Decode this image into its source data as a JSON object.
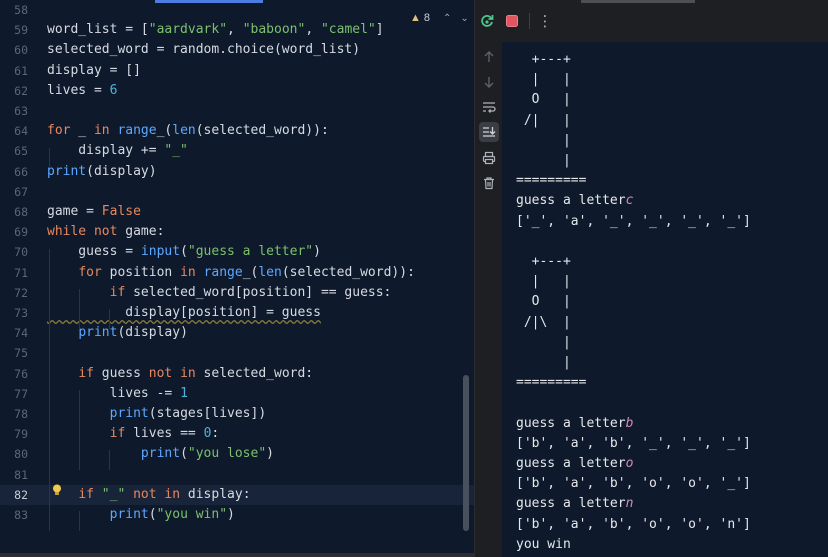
{
  "editor": {
    "warnings": {
      "count": "8"
    },
    "lines": [
      {
        "n": "58",
        "t": []
      },
      {
        "n": "59",
        "t": [
          {
            "s": "word_list = [",
            "c": ""
          },
          {
            "s": "\"aardvark\"",
            "c": "str"
          },
          {
            "s": ", ",
            "c": ""
          },
          {
            "s": "\"baboon\"",
            "c": "str"
          },
          {
            "s": ", ",
            "c": ""
          },
          {
            "s": "\"camel\"",
            "c": "str"
          },
          {
            "s": "]",
            "c": ""
          }
        ]
      },
      {
        "n": "60",
        "t": [
          {
            "s": "selected_word = random.choice(word_list)",
            "c": ""
          }
        ]
      },
      {
        "n": "61",
        "t": [
          {
            "s": "display = []",
            "c": ""
          }
        ]
      },
      {
        "n": "62",
        "t": [
          {
            "s": "lives = ",
            "c": ""
          },
          {
            "s": "6",
            "c": "num"
          }
        ]
      },
      {
        "n": "63",
        "t": []
      },
      {
        "n": "64",
        "t": [
          {
            "s": "for",
            "c": "kw"
          },
          {
            "s": " _ ",
            "c": ""
          },
          {
            "s": "in",
            "c": "kw"
          },
          {
            "s": " ",
            "c": ""
          },
          {
            "s": "range",
            "c": "fn"
          },
          {
            "s": "_(",
            "c": ""
          },
          {
            "s": "len",
            "c": "fn"
          },
          {
            "s": "(selected_word)):",
            "c": ""
          }
        ]
      },
      {
        "n": "65",
        "t": [
          {
            "s": "    display += ",
            "c": ""
          },
          {
            "s": "\"_\"",
            "c": "str"
          }
        ]
      },
      {
        "n": "66",
        "t": [
          {
            "s": "print",
            "c": "fn"
          },
          {
            "s": "(display)",
            "c": ""
          }
        ]
      },
      {
        "n": "67",
        "t": []
      },
      {
        "n": "68",
        "t": [
          {
            "s": "game = ",
            "c": ""
          },
          {
            "s": "False",
            "c": "kw"
          }
        ]
      },
      {
        "n": "69",
        "t": [
          {
            "s": "while",
            "c": "kw"
          },
          {
            "s": " ",
            "c": ""
          },
          {
            "s": "not",
            "c": "kw"
          },
          {
            "s": " game:",
            "c": ""
          }
        ]
      },
      {
        "n": "70",
        "t": [
          {
            "s": "    guess = ",
            "c": ""
          },
          {
            "s": "input",
            "c": "fn"
          },
          {
            "s": "(",
            "c": ""
          },
          {
            "s": "\"guess a letter\"",
            "c": "str"
          },
          {
            "s": ")",
            "c": ""
          }
        ]
      },
      {
        "n": "71",
        "t": [
          {
            "s": "    ",
            "c": ""
          },
          {
            "s": "for",
            "c": "kw"
          },
          {
            "s": " position ",
            "c": ""
          },
          {
            "s": "in",
            "c": "kw"
          },
          {
            "s": " ",
            "c": ""
          },
          {
            "s": "range",
            "c": "fn"
          },
          {
            "s": "_(",
            "c": ""
          },
          {
            "s": "len",
            "c": "fn"
          },
          {
            "s": "(selected_word)):",
            "c": ""
          }
        ]
      },
      {
        "n": "72",
        "t": [
          {
            "s": "        ",
            "c": ""
          },
          {
            "s": "if",
            "c": "kw"
          },
          {
            "s": " selected_word[position] == guess:",
            "c": ""
          }
        ]
      },
      {
        "n": "73",
        "t": [
          {
            "s": "          display[position] = guess",
            "c": ""
          }
        ]
      },
      {
        "n": "74",
        "t": [
          {
            "s": "    ",
            "c": ""
          },
          {
            "s": "print",
            "c": "fn"
          },
          {
            "s": "(display)",
            "c": ""
          }
        ]
      },
      {
        "n": "75",
        "t": []
      },
      {
        "n": "76",
        "t": [
          {
            "s": "    ",
            "c": ""
          },
          {
            "s": "if",
            "c": "kw"
          },
          {
            "s": " guess ",
            "c": ""
          },
          {
            "s": "not in",
            "c": "kw"
          },
          {
            "s": " selected_word:",
            "c": ""
          }
        ]
      },
      {
        "n": "77",
        "t": [
          {
            "s": "        lives -= ",
            "c": ""
          },
          {
            "s": "1",
            "c": "num"
          }
        ]
      },
      {
        "n": "78",
        "t": [
          {
            "s": "        ",
            "c": ""
          },
          {
            "s": "print",
            "c": "fn"
          },
          {
            "s": "(stages[lives])",
            "c": ""
          }
        ]
      },
      {
        "n": "79",
        "t": [
          {
            "s": "        ",
            "c": ""
          },
          {
            "s": "if",
            "c": "kw"
          },
          {
            "s": " lives == ",
            "c": ""
          },
          {
            "s": "0",
            "c": "num"
          },
          {
            "s": ":",
            "c": ""
          }
        ]
      },
      {
        "n": "80",
        "t": [
          {
            "s": "            ",
            "c": ""
          },
          {
            "s": "print",
            "c": "fn"
          },
          {
            "s": "(",
            "c": ""
          },
          {
            "s": "\"you lose\"",
            "c": "str"
          },
          {
            "s": ")",
            "c": ""
          }
        ]
      },
      {
        "n": "81",
        "t": []
      },
      {
        "n": "82",
        "t": [
          {
            "s": "    ",
            "c": ""
          },
          {
            "s": "if",
            "c": "kw"
          },
          {
            "s": " ",
            "c": ""
          },
          {
            "s": "\"_\"",
            "c": "str"
          },
          {
            "s": " ",
            "c": ""
          },
          {
            "s": "not in",
            "c": "kw"
          },
          {
            "s": " display:",
            "c": ""
          }
        ]
      },
      {
        "n": "83",
        "t": [
          {
            "s": "        ",
            "c": ""
          },
          {
            "s": "print",
            "c": "fn"
          },
          {
            "s": "(",
            "c": ""
          },
          {
            "s": "\"you win\"",
            "c": "str"
          },
          {
            "s": ")",
            "c": ""
          }
        ]
      }
    ]
  },
  "console": {
    "lines": [
      {
        "t": [
          {
            "s": "  +---+",
            "c": ""
          }
        ]
      },
      {
        "t": [
          {
            "s": "  |   |",
            "c": ""
          }
        ]
      },
      {
        "t": [
          {
            "s": "  O   |",
            "c": ""
          }
        ]
      },
      {
        "t": [
          {
            "s": " /|   |",
            "c": ""
          }
        ]
      },
      {
        "t": [
          {
            "s": "      |",
            "c": ""
          }
        ]
      },
      {
        "t": [
          {
            "s": "      |",
            "c": ""
          }
        ]
      },
      {
        "t": [
          {
            "s": "=========",
            "c": ""
          }
        ]
      },
      {
        "t": [
          {
            "s": "guess a letter",
            "c": ""
          },
          {
            "s": "c",
            "c": "inp"
          }
        ]
      },
      {
        "t": [
          {
            "s": "['_', 'a', '_', '_', '_', '_']",
            "c": ""
          }
        ]
      },
      {
        "t": []
      },
      {
        "t": [
          {
            "s": "  +---+",
            "c": ""
          }
        ]
      },
      {
        "t": [
          {
            "s": "  |   |",
            "c": ""
          }
        ]
      },
      {
        "t": [
          {
            "s": "  O   |",
            "c": ""
          }
        ]
      },
      {
        "t": [
          {
            "s": " /|\\  |",
            "c": ""
          }
        ]
      },
      {
        "t": [
          {
            "s": "      |",
            "c": ""
          }
        ]
      },
      {
        "t": [
          {
            "s": "      |",
            "c": ""
          }
        ]
      },
      {
        "t": [
          {
            "s": "=========",
            "c": ""
          }
        ]
      },
      {
        "t": []
      },
      {
        "t": [
          {
            "s": "guess a letter",
            "c": ""
          },
          {
            "s": "b",
            "c": "inp"
          }
        ]
      },
      {
        "t": [
          {
            "s": "['b', 'a', 'b', '_', '_', '_']",
            "c": ""
          }
        ]
      },
      {
        "t": [
          {
            "s": "guess a letter",
            "c": ""
          },
          {
            "s": "o",
            "c": "inp"
          }
        ]
      },
      {
        "t": [
          {
            "s": "['b', 'a', 'b', 'o', 'o', '_']",
            "c": ""
          }
        ]
      },
      {
        "t": [
          {
            "s": "guess a letter",
            "c": ""
          },
          {
            "s": "n",
            "c": "inp"
          }
        ]
      },
      {
        "t": [
          {
            "s": "['b', 'a', 'b', 'o', 'o', 'n']",
            "c": ""
          }
        ]
      },
      {
        "t": [
          {
            "s": "you win",
            "c": ""
          }
        ]
      }
    ]
  },
  "toolbar": {
    "rerun_icon": "rerun-icon",
    "stop_icon": "stop-icon",
    "more_label": "⋮"
  },
  "rail": {
    "icons": [
      "up-arrow-icon",
      "down-arrow-icon",
      "soft-wrap-icon",
      "scroll-to-end-icon",
      "print-icon",
      "trash-icon"
    ]
  },
  "colors": {
    "editor_bg": "#0e1a2b",
    "keyword": "#e7885d",
    "string": "#7cc06f",
    "number": "#4fb3d9",
    "function": "#5da7ff",
    "user_input": "#d68ab6"
  }
}
